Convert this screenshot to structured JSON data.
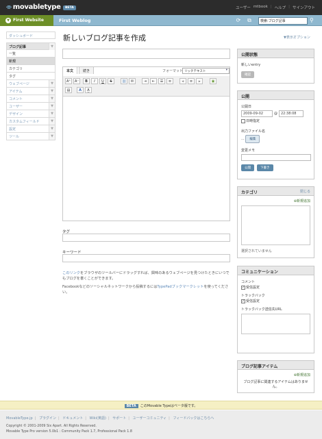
{
  "header": {
    "logo": "movabletype",
    "beta": "BETA",
    "user_menu": [
      "ユーザー",
      "mtbook",
      "ヘルプ",
      "サインアウト"
    ]
  },
  "bluebar": {
    "website": "First Website",
    "blog": "First Weblog",
    "search_value": "検索:ブログ記事"
  },
  "sidebar": {
    "dashboard": "ダッシュボード",
    "open_section": "ブログ記事",
    "sub_items": [
      "一覧",
      "新規",
      "カテゴリ",
      "タグ"
    ],
    "sections": [
      "ウェブページ",
      "アイテム",
      "コメント",
      "ユーザー",
      "デザイン",
      "カスタムフィールド",
      "設定",
      "ツール"
    ]
  },
  "main": {
    "title": "新しいブログ記事を作成",
    "display_options": "▼表示オプション",
    "tabs": [
      "本文",
      "続き"
    ],
    "format_label": "フォーマット",
    "format_value": "リッチテキスト",
    "tags_label": "タグ",
    "keywords_label": "キーワード",
    "help1_link": "このリンク",
    "help1_text": "をブラウザのツールバーにドラッグすれば、興味のあるウェブページを見つけたときにいつでもブログを書くことができます。",
    "help2_pre": "Facebookなどのソーシャルネットワークから投稿するには",
    "help2_link": "TypePadブックマークレット",
    "help2_post": "を使ってください。"
  },
  "toolbar_buttons": [
    "A",
    "A",
    "B",
    "I",
    "U",
    "S",
    "link",
    "email",
    "indent",
    "outdent",
    "ul",
    "ol",
    "left",
    "center",
    "right",
    "image",
    "file",
    "color",
    "A"
  ],
  "status_widget": {
    "title": "公開状態",
    "state": "新しいentry",
    "preview": "確認"
  },
  "publish_widget": {
    "title": "公開",
    "date_label": "公開日",
    "date": "2009-09-02",
    "at": "@",
    "time": "22:38:08",
    "timed_label": "日時指定",
    "filename_label": "出力ファイル名",
    "filename_prefix": "...",
    "edit_button": "編集",
    "memo_label": "変更メモ",
    "publish_button": "公開",
    "draft_button": "下書き"
  },
  "category_widget": {
    "title": "カテゴリ",
    "close": "閉じる",
    "add_new": "新規追加",
    "none": "選択されていません"
  },
  "communication_widget": {
    "title": "コミュニケーション",
    "comments_label": "コメント",
    "comments_accept": "受信設定",
    "trackback_label": "トラックバック",
    "trackback_accept": "受信設定",
    "trackback_url_label": "トラックバック送信先URL"
  },
  "items_widget": {
    "title": "ブログ記事アイテム",
    "add_new": "新規追加",
    "empty": "ブログ記事に関連するアイテムはありません。"
  },
  "betabar": {
    "badge": "BETA",
    "text": "このMovable Typeはベータ版です。"
  },
  "footer": {
    "links": [
      "MovableType.jp",
      "プラグイン",
      "ドキュメント",
      "Wiki(英語)",
      "サポート",
      "ユーザーコミュニティ",
      "フィードバックはこちらへ"
    ],
    "copyright": "Copyright © 2001-2009 Six Apart. All Rights Reserved.",
    "version": "Movable Type Pro version 5.0b1 : Community Pack 1.7, Professional Pack 1.8"
  }
}
